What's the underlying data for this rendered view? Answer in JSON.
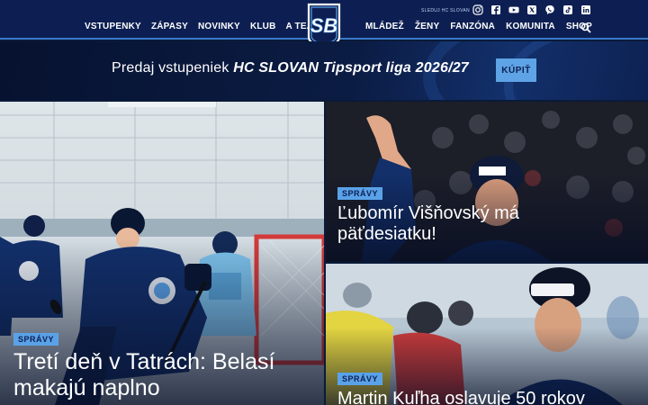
{
  "header": {
    "logo_text": "SB",
    "nav_left": [
      "VSTUPENKY",
      "ZÁPASY",
      "NOVINKY",
      "KLUB",
      "A TEAM"
    ],
    "nav_right": [
      "MLÁDEŽ",
      "ŽENY",
      "FANZÓNA",
      "KOMUNITA",
      "SHOP"
    ],
    "follow_label": "SLEDUJ HC SLOVAN",
    "socials": [
      "instagram-icon",
      "facebook-icon",
      "youtube-icon",
      "x-icon",
      "viber-icon",
      "tiktok-icon",
      "linkedin-icon"
    ],
    "search_icon": "search-icon"
  },
  "promo": {
    "text_prefix": "Predaj vstupeniek ",
    "text_emphasis": "HC SLOVAN Tipsport liga 2026/27",
    "button_label": "KÚPIŤ"
  },
  "articles": [
    {
      "tag": "SPRÁVY",
      "title": "Tretí deň v Tatrách: Belasí makajú naplno"
    },
    {
      "tag": "SPRÁVY",
      "title": "Ľubomír Višňovský má päťdesiatku!"
    },
    {
      "tag": "SPRÁVY",
      "title": "Martin Kuľha oslavuje 50 rokov"
    }
  ],
  "colors": {
    "header_bg": "#0d1f52",
    "accent": "#5aa2e8",
    "accent_line": "#3a78c9"
  }
}
